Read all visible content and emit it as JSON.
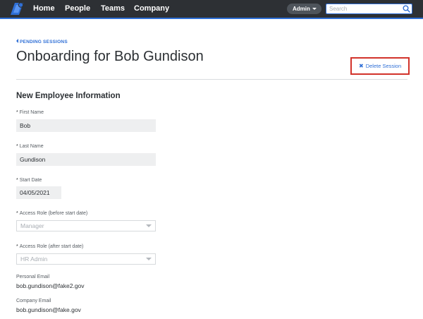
{
  "nav": {
    "items": [
      "Home",
      "People",
      "Teams",
      "Company"
    ],
    "admin_label": "Admin",
    "search_placeholder": "Search"
  },
  "header": {
    "back_link": "PENDING SESSIONS",
    "title": "Onboarding for Bob Gundison",
    "delete_button": "Delete Session"
  },
  "section": {
    "title": "New Employee Information"
  },
  "fields": {
    "first_name": {
      "required_mark": "*",
      "label": "First Name",
      "value": "Bob"
    },
    "last_name": {
      "required_mark": "*",
      "label": "Last Name",
      "value": "Gundison"
    },
    "start_date": {
      "required_mark": "*",
      "label": "Start Date",
      "value": "04/05/2021"
    },
    "access_before": {
      "required_mark": "*",
      "label": "Access Role (before start date)",
      "value": "Manager"
    },
    "access_after": {
      "required_mark": "*",
      "label": "Access Role (after start date)",
      "value": "HR Admin"
    },
    "personal_email": {
      "label": "Personal Email",
      "value": "bob.gundison@fake2.gov"
    },
    "company_email": {
      "label": "Company Email",
      "value": "bob.gundison@fake.gov"
    }
  },
  "colors": {
    "nav_bg": "#2d3034",
    "accent": "#2f6fd6",
    "danger": "#d2332b"
  },
  "icons": [
    "logo-icon",
    "search-icon",
    "chevron-down-icon",
    "chevron-left-icon",
    "close-icon"
  ]
}
